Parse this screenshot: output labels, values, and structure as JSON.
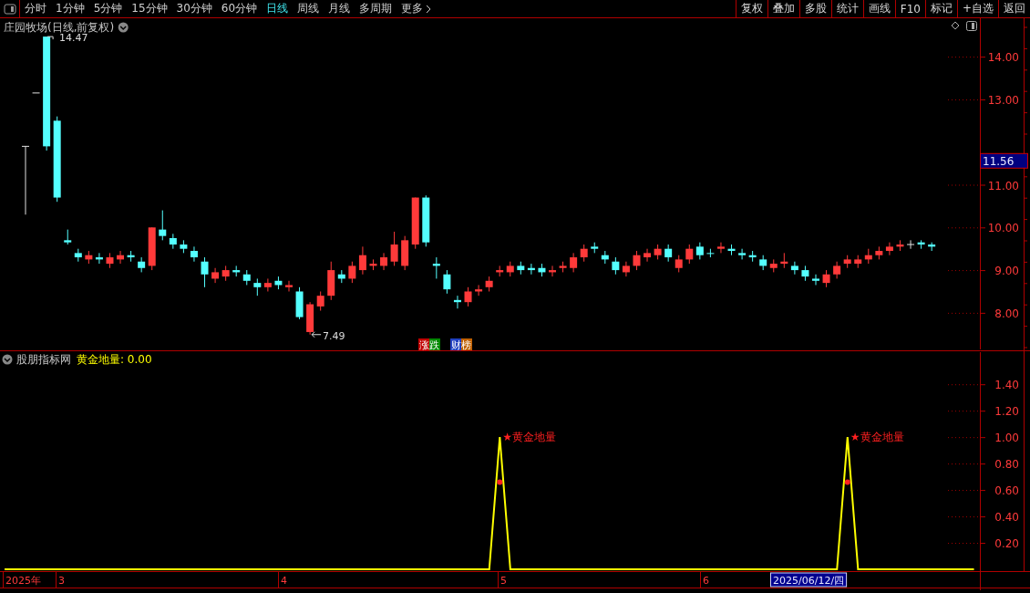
{
  "toolbar": {
    "tabs": [
      {
        "label": "分时",
        "selected": false
      },
      {
        "label": "1分钟",
        "selected": false
      },
      {
        "label": "5分钟",
        "selected": false
      },
      {
        "label": "15分钟",
        "selected": false
      },
      {
        "label": "30分钟",
        "selected": false
      },
      {
        "label": "60分钟",
        "selected": false
      },
      {
        "label": "日线",
        "selected": true
      },
      {
        "label": "周线",
        "selected": false
      },
      {
        "label": "月线",
        "selected": false
      },
      {
        "label": "多周期",
        "selected": false
      },
      {
        "label": "更多",
        "selected": false
      }
    ],
    "buttons": [
      "复权",
      "叠加",
      "多股",
      "统计",
      "画线",
      "F10",
      "标记",
      "+自选",
      "返回"
    ]
  },
  "price_panel": {
    "title": "庄园牧场(日线,前复权)",
    "current_price": "11.56",
    "badges": [
      {
        "label": "涨跌",
        "kind": "updown"
      },
      {
        "label": "财榜",
        "kind": "money"
      }
    ],
    "chart_data": {
      "type": "candlestick",
      "ylim": [
        7.1,
        14.9
      ],
      "categories": [
        null,
        null,
        null,
        null,
        null,
        null,
        null,
        null,
        null,
        null,
        null,
        null,
        null,
        null,
        null,
        null,
        null,
        null,
        null,
        null,
        null,
        null,
        null,
        null,
        null,
        null,
        null,
        null,
        null,
        null,
        null,
        null,
        null,
        null,
        null,
        null,
        null,
        null,
        null,
        null,
        null,
        null,
        null,
        null,
        null,
        null,
        null,
        null,
        null,
        null,
        null,
        null,
        null,
        null,
        null,
        null,
        null,
        null,
        null,
        null,
        null,
        null,
        null,
        null,
        null,
        null,
        null,
        null,
        null,
        null,
        null,
        null,
        null,
        null,
        null,
        null,
        null,
        null,
        null,
        null,
        null,
        null,
        null,
        null,
        null,
        null,
        null
      ],
      "yticks": [
        {
          "value": 14,
          "label": "14.00"
        },
        {
          "value": 13,
          "label": "13.00"
        },
        {
          "value": 11,
          "label": "11.00"
        },
        {
          "value": 10,
          "label": "10.00"
        },
        {
          "value": 9,
          "label": "9.00"
        },
        {
          "value": 8,
          "label": "8.00"
        }
      ],
      "ohlc": [
        [
          11.9,
          11.9,
          10.3,
          11.9
        ],
        [
          13.15,
          13.15,
          13.15,
          13.15
        ],
        [
          14.47,
          14.47,
          11.8,
          11.9
        ],
        [
          12.5,
          12.6,
          10.6,
          10.7
        ],
        [
          9.7,
          9.95,
          9.6,
          9.65
        ],
        [
          9.4,
          9.5,
          9.2,
          9.3
        ],
        [
          9.25,
          9.45,
          9.15,
          9.35
        ],
        [
          9.3,
          9.4,
          9.15,
          9.25
        ],
        [
          9.15,
          9.4,
          9.05,
          9.3
        ],
        [
          9.25,
          9.45,
          9.15,
          9.35
        ],
        [
          9.35,
          9.45,
          9.2,
          9.3
        ],
        [
          9.2,
          9.3,
          8.95,
          9.05
        ],
        [
          9.1,
          10.0,
          9.0,
          10.0
        ],
        [
          9.95,
          10.4,
          9.7,
          9.8
        ],
        [
          9.75,
          9.85,
          9.5,
          9.6
        ],
        [
          9.6,
          9.7,
          9.4,
          9.5
        ],
        [
          9.45,
          9.55,
          9.2,
          9.3
        ],
        [
          9.2,
          9.3,
          8.6,
          8.9
        ],
        [
          8.8,
          9.05,
          8.7,
          8.95
        ],
        [
          8.85,
          9.1,
          8.75,
          9.0
        ],
        [
          9.0,
          9.1,
          8.85,
          8.95
        ],
        [
          8.9,
          9.0,
          8.65,
          8.75
        ],
        [
          8.7,
          8.8,
          8.4,
          8.6
        ],
        [
          8.6,
          8.8,
          8.5,
          8.7
        ],
        [
          8.75,
          8.85,
          8.55,
          8.65
        ],
        [
          8.6,
          8.75,
          8.5,
          8.65
        ],
        [
          8.5,
          8.6,
          7.85,
          7.9
        ],
        [
          7.55,
          8.25,
          7.49,
          8.2
        ],
        [
          8.15,
          8.5,
          8.05,
          8.4
        ],
        [
          8.4,
          9.2,
          8.3,
          9.0
        ],
        [
          8.9,
          9.0,
          8.7,
          8.8
        ],
        [
          8.8,
          9.2,
          8.7,
          9.1
        ],
        [
          9.0,
          9.55,
          8.9,
          9.35
        ],
        [
          9.1,
          9.25,
          9.0,
          9.15
        ],
        [
          9.1,
          9.4,
          9.0,
          9.3
        ],
        [
          9.2,
          9.9,
          9.1,
          9.6
        ],
        [
          9.1,
          9.8,
          9.0,
          9.7
        ],
        [
          9.6,
          10.7,
          9.5,
          10.7
        ],
        [
          10.7,
          10.75,
          9.55,
          9.65
        ],
        [
          9.15,
          9.3,
          8.8,
          9.1
        ],
        [
          8.9,
          9.0,
          8.45,
          8.55
        ],
        [
          8.3,
          8.4,
          8.1,
          8.25
        ],
        [
          8.25,
          8.6,
          8.15,
          8.5
        ],
        [
          8.5,
          8.65,
          8.4,
          8.55
        ],
        [
          8.6,
          8.85,
          8.5,
          8.75
        ],
        [
          8.95,
          9.1,
          8.85,
          9.0
        ],
        [
          8.95,
          9.2,
          8.85,
          9.1
        ],
        [
          9.1,
          9.2,
          8.9,
          9.0
        ],
        [
          9.05,
          9.15,
          8.9,
          9.0
        ],
        [
          9.05,
          9.15,
          8.85,
          8.95
        ],
        [
          8.95,
          9.1,
          8.85,
          9.0
        ],
        [
          9.05,
          9.2,
          8.95,
          9.1
        ],
        [
          9.05,
          9.4,
          8.95,
          9.3
        ],
        [
          9.3,
          9.6,
          9.2,
          9.5
        ],
        [
          9.55,
          9.65,
          9.4,
          9.5
        ],
        [
          9.35,
          9.45,
          9.15,
          9.25
        ],
        [
          9.2,
          9.3,
          8.9,
          9.0
        ],
        [
          8.95,
          9.2,
          8.85,
          9.1
        ],
        [
          9.1,
          9.45,
          9.0,
          9.35
        ],
        [
          9.3,
          9.5,
          9.2,
          9.4
        ],
        [
          9.35,
          9.6,
          9.25,
          9.5
        ],
        [
          9.5,
          9.6,
          9.2,
          9.3
        ],
        [
          9.05,
          9.35,
          8.95,
          9.25
        ],
        [
          9.25,
          9.6,
          9.15,
          9.5
        ],
        [
          9.55,
          9.65,
          9.25,
          9.35
        ],
        [
          9.4,
          9.5,
          9.3,
          9.38
        ],
        [
          9.5,
          9.65,
          9.4,
          9.55
        ],
        [
          9.5,
          9.6,
          9.35,
          9.45
        ],
        [
          9.4,
          9.5,
          9.25,
          9.35
        ],
        [
          9.35,
          9.45,
          9.2,
          9.3
        ],
        [
          9.25,
          9.35,
          9.0,
          9.1
        ],
        [
          9.05,
          9.25,
          8.95,
          9.15
        ],
        [
          9.15,
          9.4,
          9.05,
          9.2
        ],
        [
          9.1,
          9.2,
          8.9,
          9.0
        ],
        [
          9.0,
          9.1,
          8.75,
          8.85
        ],
        [
          8.8,
          8.9,
          8.65,
          8.75
        ],
        [
          8.7,
          9.0,
          8.6,
          8.9
        ],
        [
          8.9,
          9.2,
          8.8,
          9.1
        ],
        [
          9.15,
          9.35,
          9.05,
          9.25
        ],
        [
          9.15,
          9.35,
          9.05,
          9.25
        ],
        [
          9.25,
          9.5,
          9.15,
          9.35
        ],
        [
          9.35,
          9.55,
          9.25,
          9.45
        ],
        [
          9.45,
          9.65,
          9.35,
          9.55
        ],
        [
          9.55,
          9.7,
          9.45,
          9.6
        ],
        [
          9.6,
          9.7,
          9.5,
          9.6
        ],
        [
          9.65,
          9.7,
          9.5,
          9.6
        ],
        [
          9.6,
          9.65,
          9.45,
          9.55
        ]
      ],
      "annotations": [
        {
          "text": "14.47"
        },
        {
          "text": "7.49"
        }
      ]
    }
  },
  "indicator_panel": {
    "name": "股朋指标网",
    "reading": "黄金地量: 0.00",
    "chart_data": {
      "type": "line",
      "ylim": [
        0,
        1.65
      ],
      "series": [
        {
          "color": "#ffff00",
          "values": [
            0,
            0,
            0,
            0,
            0,
            0,
            0,
            0,
            0,
            0,
            0,
            0,
            0,
            0,
            0,
            0,
            0,
            0,
            0,
            0,
            0,
            0,
            0,
            0,
            0,
            0,
            0,
            0,
            0,
            0,
            0,
            0,
            0,
            0,
            0,
            0,
            0,
            0,
            0,
            0,
            0,
            0,
            0,
            0,
            0,
            0,
            0,
            1,
            0,
            0,
            0,
            0,
            0,
            0,
            0,
            0,
            0,
            0,
            0,
            0,
            0,
            0,
            0,
            0,
            0,
            0,
            0,
            0,
            0,
            0,
            0,
            0,
            0,
            0,
            0,
            0,
            0,
            0,
            0,
            0,
            1,
            0,
            0,
            0,
            0,
            0,
            0,
            0,
            0,
            0,
            0,
            0,
            0
          ]
        },
        {
          "type": "scatter",
          "color": "#ff2020",
          "values": [
            null,
            null,
            null,
            null,
            null,
            null,
            null,
            null,
            null,
            null,
            null,
            null,
            null,
            null,
            null,
            null,
            null,
            null,
            null,
            null,
            null,
            null,
            null,
            null,
            null,
            null,
            null,
            null,
            null,
            null,
            null,
            null,
            null,
            null,
            null,
            null,
            null,
            null,
            null,
            null,
            null,
            null,
            null,
            null,
            null,
            null,
            null,
            0.66,
            null,
            null,
            null,
            null,
            null,
            null,
            null,
            null,
            null,
            null,
            null,
            null,
            null,
            null,
            null,
            null,
            null,
            null,
            null,
            null,
            null,
            null,
            null,
            null,
            null,
            null,
            null,
            null,
            null,
            null,
            null,
            null,
            0.66,
            null,
            null,
            null,
            null,
            null,
            null,
            null,
            null,
            null,
            null,
            null,
            null
          ]
        }
      ],
      "yticks": [
        {
          "value": 0.2,
          "label": "0.20"
        },
        {
          "value": 0.4,
          "label": "0.40"
        },
        {
          "value": 0.6,
          "label": "0.60"
        },
        {
          "value": 0.8,
          "label": "0.80"
        },
        {
          "value": 1.0,
          "label": "1.00"
        },
        {
          "value": 1.2,
          "label": "1.20"
        },
        {
          "value": 1.4,
          "label": "1.40"
        }
      ],
      "annotations": [
        {
          "text": "★黄金地量"
        },
        {
          "text": "★黄金地量"
        }
      ]
    },
    "date_axis": [
      "2025年",
      "3",
      "4",
      "5",
      "6"
    ],
    "cursor_date": "2025/06/12/四"
  }
}
